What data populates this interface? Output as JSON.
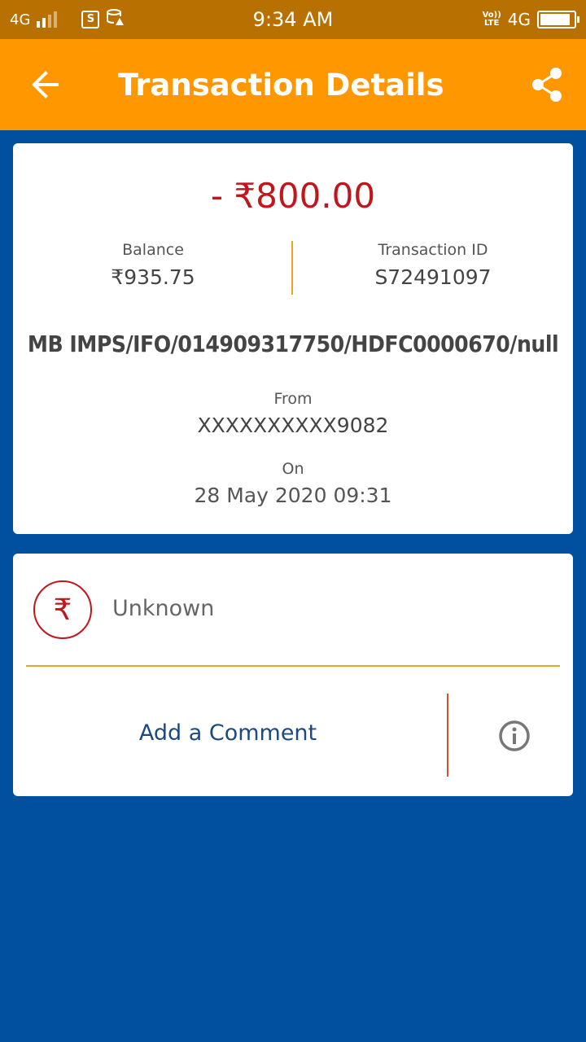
{
  "status_bar": {
    "network_left": "4G",
    "time": "9:34 AM",
    "network_right": "4G",
    "volte_top": "Vo))",
    "volte_bottom": "LTE",
    "sim_icon_label": "S"
  },
  "app_bar": {
    "title": "Transaction Details",
    "back_icon": "arrow-left-icon",
    "share_icon": "share-icon",
    "background_color": "#ff9800"
  },
  "transaction": {
    "amount": "- ₹800.00",
    "balance_label": "Balance",
    "balance_value": "₹935.75",
    "txn_id_label": "Transaction ID",
    "txn_id_value": "S72491097",
    "description": "MB IMPS/IFO/014909317750/HDFC0000670/null",
    "from_label": "From",
    "from_value": "XXXXXXXXXX9082",
    "on_label": "On",
    "on_value": "28 May 2020 09:31",
    "amount_color": "#c0161c"
  },
  "category": {
    "icon_symbol": "₹",
    "label": "Unknown"
  },
  "actions": {
    "add_comment": "Add a Comment",
    "info_icon": "info-icon"
  },
  "colors": {
    "page_background": "#0050a0",
    "status_bar": "#b87100",
    "accent_divider": "#f0a030"
  }
}
